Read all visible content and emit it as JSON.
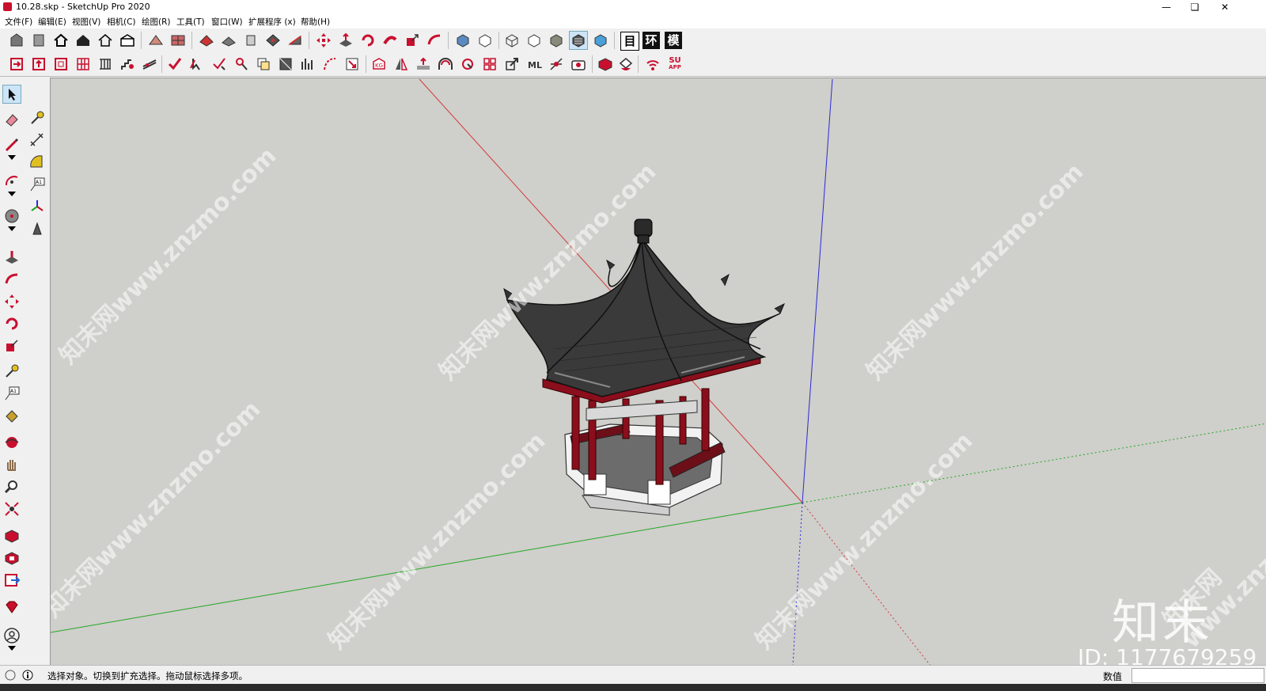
{
  "window": {
    "title": "10.28.skp - SketchUp Pro 2020"
  },
  "menu": [
    "文件(F)",
    "编辑(E)",
    "视图(V)",
    "相机(C)",
    "绘图(R)",
    "工具(T)",
    "窗口(W)",
    "扩展程序 (x)",
    "帮助(H)"
  ],
  "toolbar_text": {
    "table": "目",
    "env": "环",
    "model": "模",
    "su": "SU",
    "app": "APP"
  },
  "colors": {
    "accent_red": "#c8102e",
    "axis_red": "#d23a3a",
    "axis_green": "#22a822",
    "axis_blue": "#2a2ad8",
    "viewport_bg": "#cfcfcb"
  },
  "status": {
    "hint": "选择对象。切换到扩充选择。拖动鼠标选择多项。",
    "measure_label": "数值",
    "measure_value": ""
  },
  "watermark": {
    "brand": "知末",
    "id": "ID: 1177679259",
    "text": "知末网www.znzmo.com"
  }
}
